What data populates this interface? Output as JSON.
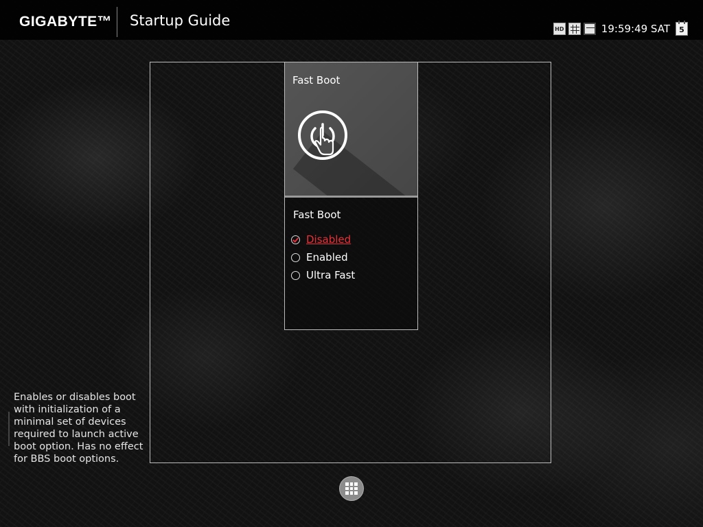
{
  "header": {
    "brand": "GIGABYTE™",
    "title": "Startup Guide",
    "status_icons": [
      "hd-display-icon",
      "grid-view-icon",
      "window-view-icon"
    ],
    "hd_label": "HD",
    "clock": "19:59:49 SAT",
    "calendar_day": "5"
  },
  "card": {
    "title": "Fast Boot",
    "icon": "power-touch-icon",
    "option_title": "Fast Boot",
    "options": [
      {
        "label": "Disabled",
        "selected": true
      },
      {
        "label": "Enabled",
        "selected": false
      },
      {
        "label": "Ultra Fast",
        "selected": false
      }
    ]
  },
  "help": {
    "text": "Enables or disables boot with initialization of a minimal set of devices required to launch active boot option. Has no effect for BBS boot options."
  },
  "footer": {
    "home_icon": "home-grid-icon"
  },
  "colors": {
    "accent": "#e8303a",
    "frame": "#bdbdbd"
  }
}
